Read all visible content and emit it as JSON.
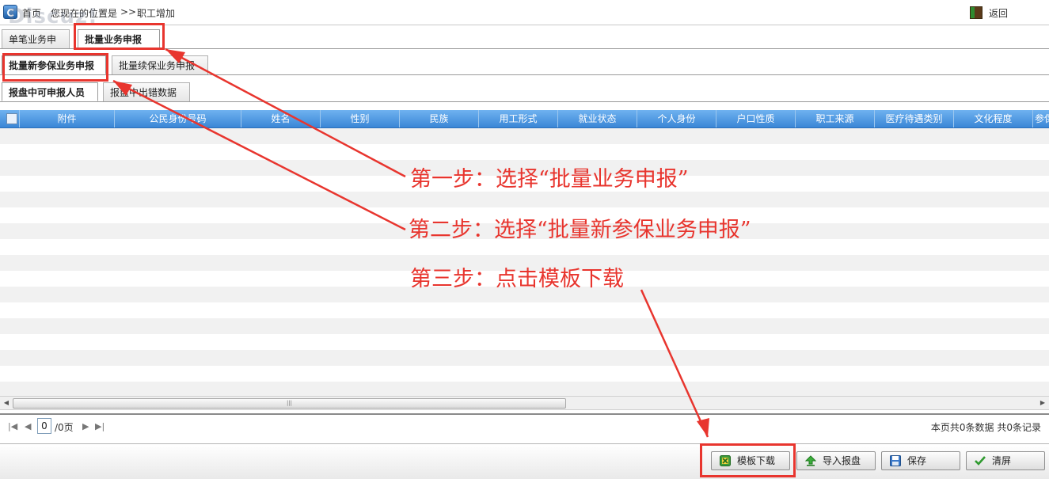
{
  "watermark": "Discuz!",
  "breadcrumb": {
    "home": "首页",
    "prefix": "您现在的位置是",
    "separator": ">>",
    "current": "职工增加"
  },
  "back_label": "返回",
  "tabs_level1": [
    "单笔业务申报",
    "批量业务申报"
  ],
  "tabs_level2": [
    "批量新参保业务申报",
    "批量续保业务申报"
  ],
  "tabs_level3": [
    "报盘中可申报人员",
    "报盘中出错数据"
  ],
  "grid": {
    "columns": [
      "附件",
      "公民身份号码",
      "姓名",
      "性别",
      "民族",
      "用工形式",
      "就业状态",
      "个人身份",
      "户口性质",
      "职工来源",
      "医疗待遇类别",
      "文化程度",
      "参保"
    ]
  },
  "pager": {
    "page_value": "0",
    "total_pages": "/0页",
    "summary": "本页共0条数据 共0条记录"
  },
  "toolbar": {
    "template_download": "模板下载",
    "import": "导入报盘",
    "save": "保存",
    "clear": "清屏"
  },
  "annotations": {
    "step1": "第一步：选择“批量业务申报”",
    "step2": "第二步：选择“批量新参保业务申报”",
    "step3": "第三步：点击模板下载",
    "color": "#e8352e"
  }
}
